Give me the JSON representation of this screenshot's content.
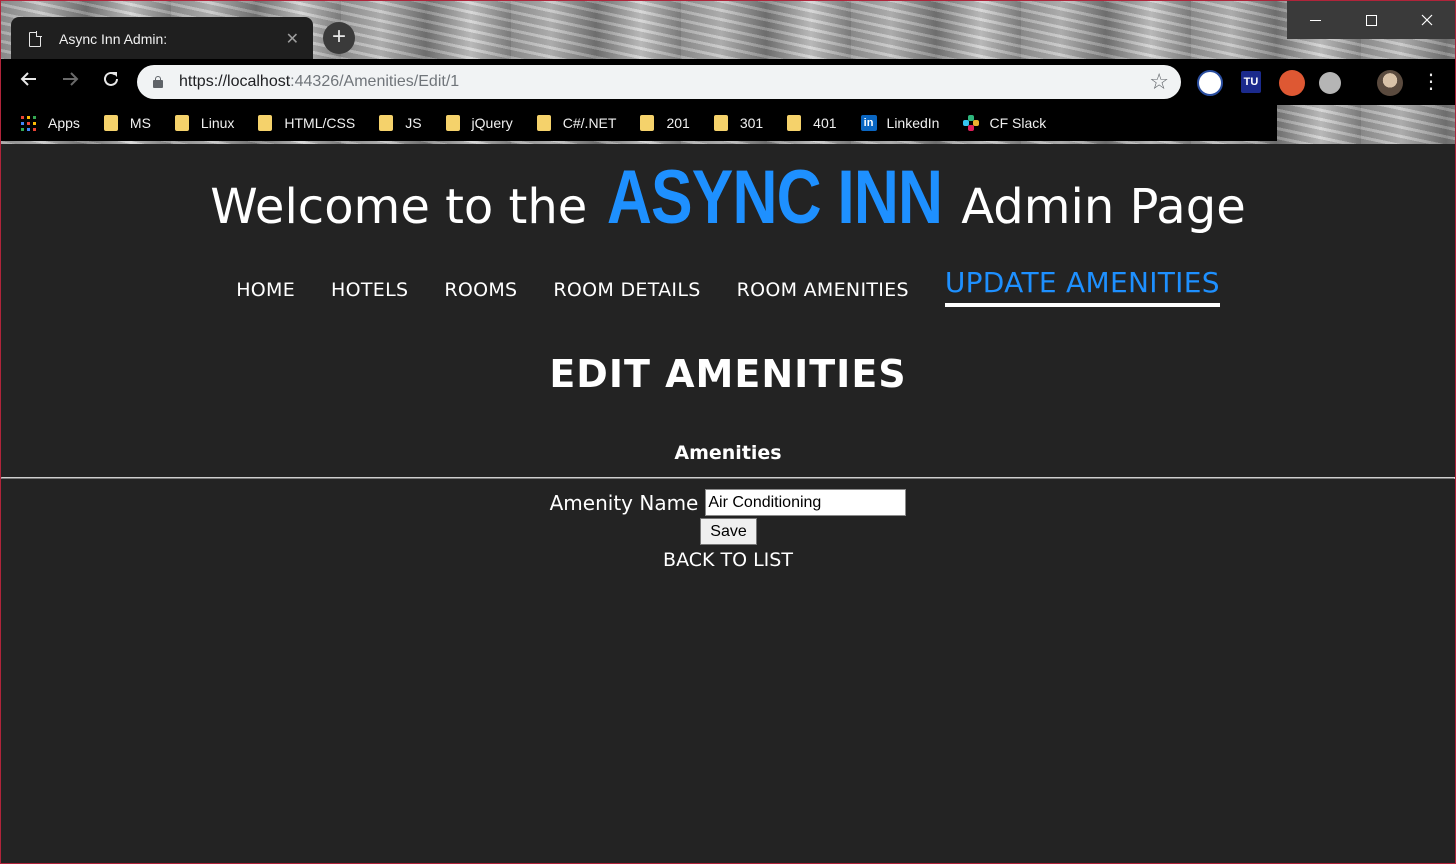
{
  "browser": {
    "tab_title": "Async Inn Admin:",
    "tab_close": "✕",
    "new_tab": "+",
    "url_host": "https://localhost",
    "url_rest": ":44326/Amenities/Edit/1",
    "bookmarks": [
      {
        "label": "Apps",
        "icon": "apps-icon"
      },
      {
        "label": "MS",
        "icon": "folder-icon"
      },
      {
        "label": "Linux",
        "icon": "folder-icon"
      },
      {
        "label": "HTML/CSS",
        "icon": "folder-icon"
      },
      {
        "label": "JS",
        "icon": "folder-icon"
      },
      {
        "label": "jQuery",
        "icon": "folder-icon"
      },
      {
        "label": "C#/.NET",
        "icon": "folder-icon"
      },
      {
        "label": "201",
        "icon": "folder-icon"
      },
      {
        "label": "301",
        "icon": "folder-icon"
      },
      {
        "label": "401",
        "icon": "folder-icon"
      },
      {
        "label": "LinkedIn",
        "icon": "linkedin-icon"
      },
      {
        "label": "CF Slack",
        "icon": "slack-icon"
      }
    ],
    "extension_tu_label": "TU"
  },
  "header": {
    "welcome_prefix": "Welcome to the",
    "brand": "ASYNC INN",
    "welcome_suffix": "Admin Page",
    "brand_color": "#1e90ff"
  },
  "nav": {
    "items": [
      {
        "label": "HOME",
        "active": false
      },
      {
        "label": "HOTELS",
        "active": false
      },
      {
        "label": "ROOMS",
        "active": false
      },
      {
        "label": "ROOM DETAILS",
        "active": false
      },
      {
        "label": "ROOM AMENITIES",
        "active": false
      },
      {
        "label": "UPDATE AMENITIES",
        "active": true
      }
    ]
  },
  "main": {
    "title": "EDIT AMENITIES",
    "section": "Amenities",
    "field_label": "Amenity Name",
    "field_value": "Air Conditioning",
    "save_label": "Save",
    "back_label": "BACK TO LIST"
  }
}
